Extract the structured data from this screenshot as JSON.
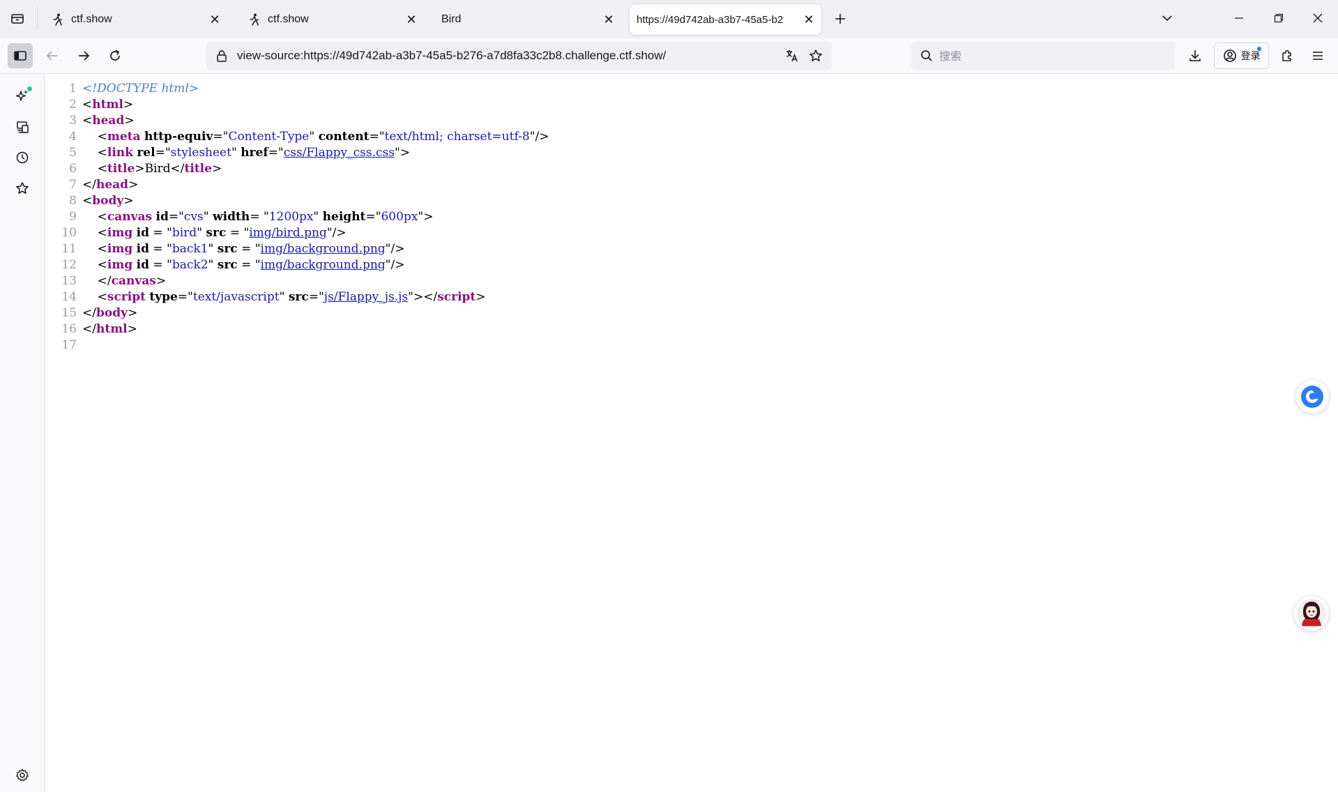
{
  "tabs": [
    {
      "title": "ctf.show",
      "favicon": "runner-icon",
      "active": false
    },
    {
      "title": "ctf.show",
      "favicon": "runner-icon",
      "active": false
    },
    {
      "title": "Bird",
      "favicon": "none",
      "active": false
    },
    {
      "title": "https://49d742ab-a3b7-45a5-b2",
      "favicon": "none",
      "active": true
    }
  ],
  "navbar": {
    "url": "view-source:https://49d742ab-a3b7-45a5-b276-a7d8fa33c2b8.challenge.ctf.show/",
    "search_placeholder": "搜索",
    "login_label": "登录"
  },
  "sidebar": {
    "items": [
      "ai-chatbot-icon",
      "synced-tabs-icon",
      "history-icon",
      "bookmarks-icon",
      "settings-icon"
    ]
  },
  "source": {
    "line_numbers": [
      "1",
      "2",
      "3",
      "4",
      "5",
      "6",
      "7",
      "8",
      "9",
      "10",
      "11",
      "12",
      "13",
      "14",
      "15",
      "16",
      "17"
    ],
    "lines": [
      [
        {
          "t": "doc",
          "s": "<!DOCTYPE html>"
        }
      ],
      [
        {
          "t": "br",
          "s": "<"
        },
        {
          "t": "tag",
          "s": "html"
        },
        {
          "t": "br",
          "s": ">"
        }
      ],
      [
        {
          "t": "br",
          "s": "<"
        },
        {
          "t": "tag",
          "s": "head"
        },
        {
          "t": "br",
          "s": ">"
        }
      ],
      [
        {
          "t": "text",
          "s": "    "
        },
        {
          "t": "br",
          "s": "<"
        },
        {
          "t": "tag",
          "s": "meta"
        },
        {
          "t": "text",
          "s": " "
        },
        {
          "t": "attr",
          "s": "http-equiv"
        },
        {
          "t": "text",
          "s": "=\""
        },
        {
          "t": "val",
          "s": "Content-Type"
        },
        {
          "t": "text",
          "s": "\" "
        },
        {
          "t": "attr",
          "s": "content"
        },
        {
          "t": "text",
          "s": "=\""
        },
        {
          "t": "val",
          "s": "text/html; charset=utf-8"
        },
        {
          "t": "text",
          "s": "\""
        },
        {
          "t": "br",
          "s": "/>"
        }
      ],
      [
        {
          "t": "text",
          "s": "    "
        },
        {
          "t": "br",
          "s": "<"
        },
        {
          "t": "tag",
          "s": "link"
        },
        {
          "t": "text",
          "s": " "
        },
        {
          "t": "attr",
          "s": "rel"
        },
        {
          "t": "text",
          "s": "=\""
        },
        {
          "t": "val",
          "s": "stylesheet"
        },
        {
          "t": "text",
          "s": "\" "
        },
        {
          "t": "attr",
          "s": "href"
        },
        {
          "t": "text",
          "s": "=\""
        },
        {
          "t": "link",
          "s": "css/Flappy_css.css"
        },
        {
          "t": "text",
          "s": "\""
        },
        {
          "t": "br",
          "s": ">"
        }
      ],
      [
        {
          "t": "text",
          "s": "    "
        },
        {
          "t": "br",
          "s": "<"
        },
        {
          "t": "tag",
          "s": "title"
        },
        {
          "t": "br",
          "s": ">"
        },
        {
          "t": "text",
          "s": "Bird"
        },
        {
          "t": "br",
          "s": "</"
        },
        {
          "t": "tag",
          "s": "title"
        },
        {
          "t": "br",
          "s": ">"
        }
      ],
      [
        {
          "t": "br",
          "s": "</"
        },
        {
          "t": "tag",
          "s": "head"
        },
        {
          "t": "br",
          "s": ">"
        }
      ],
      [
        {
          "t": "br",
          "s": "<"
        },
        {
          "t": "tag",
          "s": "body"
        },
        {
          "t": "br",
          "s": ">"
        }
      ],
      [
        {
          "t": "text",
          "s": "    "
        },
        {
          "t": "br",
          "s": "<"
        },
        {
          "t": "tag",
          "s": "canvas"
        },
        {
          "t": "text",
          "s": " "
        },
        {
          "t": "attr",
          "s": "id"
        },
        {
          "t": "text",
          "s": "=\""
        },
        {
          "t": "val",
          "s": "cvs"
        },
        {
          "t": "text",
          "s": "\" "
        },
        {
          "t": "attr",
          "s": "width"
        },
        {
          "t": "text",
          "s": "= \""
        },
        {
          "t": "val",
          "s": "1200px"
        },
        {
          "t": "text",
          "s": "\" "
        },
        {
          "t": "attr",
          "s": "height"
        },
        {
          "t": "text",
          "s": "=\""
        },
        {
          "t": "val",
          "s": "600px"
        },
        {
          "t": "text",
          "s": "\""
        },
        {
          "t": "br",
          "s": ">"
        }
      ],
      [
        {
          "t": "text",
          "s": "    "
        },
        {
          "t": "br",
          "s": "<"
        },
        {
          "t": "tag",
          "s": "img"
        },
        {
          "t": "text",
          "s": " "
        },
        {
          "t": "attr",
          "s": "id"
        },
        {
          "t": "text",
          "s": " = \""
        },
        {
          "t": "val",
          "s": "bird"
        },
        {
          "t": "text",
          "s": "\" "
        },
        {
          "t": "attr",
          "s": "src"
        },
        {
          "t": "text",
          "s": " = \""
        },
        {
          "t": "link",
          "s": "img/bird.png"
        },
        {
          "t": "text",
          "s": "\""
        },
        {
          "t": "br",
          "s": "/>"
        }
      ],
      [
        {
          "t": "text",
          "s": "    "
        },
        {
          "t": "br",
          "s": "<"
        },
        {
          "t": "tag",
          "s": "img"
        },
        {
          "t": "text",
          "s": " "
        },
        {
          "t": "attr",
          "s": "id"
        },
        {
          "t": "text",
          "s": " = \""
        },
        {
          "t": "val",
          "s": "back1"
        },
        {
          "t": "text",
          "s": "\" "
        },
        {
          "t": "attr",
          "s": "src"
        },
        {
          "t": "text",
          "s": " = \""
        },
        {
          "t": "link",
          "s": "img/background.png"
        },
        {
          "t": "text",
          "s": "\""
        },
        {
          "t": "br",
          "s": "/>"
        }
      ],
      [
        {
          "t": "text",
          "s": "    "
        },
        {
          "t": "br",
          "s": "<"
        },
        {
          "t": "tag",
          "s": "img"
        },
        {
          "t": "text",
          "s": " "
        },
        {
          "t": "attr",
          "s": "id"
        },
        {
          "t": "text",
          "s": " = \""
        },
        {
          "t": "val",
          "s": "back2"
        },
        {
          "t": "text",
          "s": "\" "
        },
        {
          "t": "attr",
          "s": "src"
        },
        {
          "t": "text",
          "s": " = \""
        },
        {
          "t": "link",
          "s": "img/background.png"
        },
        {
          "t": "text",
          "s": "\""
        },
        {
          "t": "br",
          "s": "/>"
        }
      ],
      [
        {
          "t": "text",
          "s": "    "
        },
        {
          "t": "br",
          "s": "</"
        },
        {
          "t": "tag",
          "s": "canvas"
        },
        {
          "t": "br",
          "s": ">"
        }
      ],
      [
        {
          "t": "text",
          "s": "    "
        },
        {
          "t": "br",
          "s": "<"
        },
        {
          "t": "tag",
          "s": "script"
        },
        {
          "t": "text",
          "s": " "
        },
        {
          "t": "attr",
          "s": "type"
        },
        {
          "t": "text",
          "s": "=\""
        },
        {
          "t": "val",
          "s": "text/javascript"
        },
        {
          "t": "text",
          "s": "\" "
        },
        {
          "t": "attr",
          "s": "src"
        },
        {
          "t": "text",
          "s": "=\""
        },
        {
          "t": "link",
          "s": "js/Flappy_js.js"
        },
        {
          "t": "text",
          "s": "\""
        },
        {
          "t": "br",
          "s": "></"
        },
        {
          "t": "tag",
          "s": "script"
        },
        {
          "t": "br",
          "s": ">"
        }
      ],
      [
        {
          "t": "br",
          "s": "</"
        },
        {
          "t": "tag",
          "s": "body"
        },
        {
          "t": "br",
          "s": ">"
        }
      ],
      [
        {
          "t": "br",
          "s": "</"
        },
        {
          "t": "tag",
          "s": "html"
        },
        {
          "t": "br",
          "s": ">"
        }
      ],
      []
    ]
  },
  "colors": {
    "tag": "#881280",
    "attr_value": "#1a1aa6",
    "doctype": "#4a7fc0",
    "line_number": "#9a9aa4",
    "ai_badge": "#2ac3a2",
    "login_badge": "#0a84ff",
    "assistant_blue": "#2d7cf6"
  }
}
